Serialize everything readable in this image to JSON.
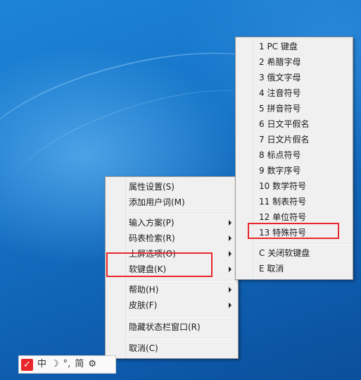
{
  "main_menu": {
    "items": [
      {
        "label": "属性设置(S)",
        "has_submenu": false
      },
      {
        "label": "添加用户词(M)",
        "has_submenu": false
      },
      {
        "label": "输入方案(P)",
        "has_submenu": true
      },
      {
        "label": "码表检索(R)",
        "has_submenu": true
      },
      {
        "label": "上屏选项(O)",
        "has_submenu": true
      },
      {
        "label": "软键盘(K)",
        "has_submenu": true
      },
      {
        "label": "帮助(H)",
        "has_submenu": true
      },
      {
        "label": "皮肤(F)",
        "has_submenu": true
      },
      {
        "label": "隐藏状态栏窗口(R)",
        "has_submenu": false
      },
      {
        "label": "取消(C)",
        "has_submenu": false
      }
    ]
  },
  "soft_keyboard_menu": {
    "items": [
      {
        "label": "1   PC 键盘"
      },
      {
        "label": "2   希腊字母"
      },
      {
        "label": "3   俄文字母"
      },
      {
        "label": "4   注音符号"
      },
      {
        "label": "5   拼音符号"
      },
      {
        "label": "6   日文平假名"
      },
      {
        "label": "7   日文片假名"
      },
      {
        "label": "8   标点符号"
      },
      {
        "label": "9   数字序号"
      },
      {
        "label": "10   数学符号"
      },
      {
        "label": "11   制表符号"
      },
      {
        "label": "12   单位符号"
      },
      {
        "label": "13   特殊符号"
      },
      {
        "label": "C 关闭软键盘"
      },
      {
        "label": "E 取消"
      }
    ]
  },
  "status_bar": {
    "logo": "✓",
    "mode": "中",
    "width_icon": "moon-icon",
    "width_symbol": "☽",
    "punctuation": "°,",
    "script": "简",
    "settings_icon": "gear-icon",
    "settings_symbol": "⚙"
  },
  "highlight_color": "#e8262c"
}
